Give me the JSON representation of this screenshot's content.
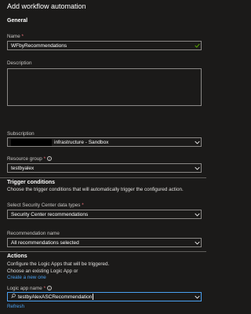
{
  "header": {
    "title": "Add workflow automation"
  },
  "general": {
    "section_title": "General",
    "name_label": "Name",
    "name_required": "*",
    "name_value": "WFbyRecommendations",
    "description_label": "Description",
    "description_value": "",
    "subscription_label": "Subscription",
    "subscription_value": "infrastructure - Sandbox",
    "resource_group_label": "Resource group",
    "resource_group_required": "*",
    "resource_group_value": "testbyalex"
  },
  "trigger": {
    "section_title": "Trigger conditions",
    "description": "Choose the trigger conditions that will automatically trigger the configured action.",
    "data_types_label": "Select Security Center data types",
    "data_types_required": "*",
    "data_types_value": "Security Center recommendations",
    "recommendation_label": "Recommendation name",
    "recommendation_value": "All recommendations selected"
  },
  "actions": {
    "section_title": "Actions",
    "line1": "Configure the Logic Apps that will be triggered.",
    "line2": "Choose an existing Logic App or",
    "create_link": "Create a new one",
    "logic_app_label": "Logic app name",
    "logic_app_required": "*",
    "logic_app_value": "testbyAlexASCRecommendation",
    "refresh_link": "Refresh"
  },
  "colors": {
    "background": "#1b1a19",
    "border": "#8a8886",
    "focus_border": "#4aa0f0",
    "link": "#4aa0f0",
    "required": "#f1707b",
    "check": "#57a300"
  },
  "icons": {
    "valid": "check-icon",
    "dropdown": "chevron-down-icon",
    "info": "info-icon",
    "search": "search-icon"
  }
}
